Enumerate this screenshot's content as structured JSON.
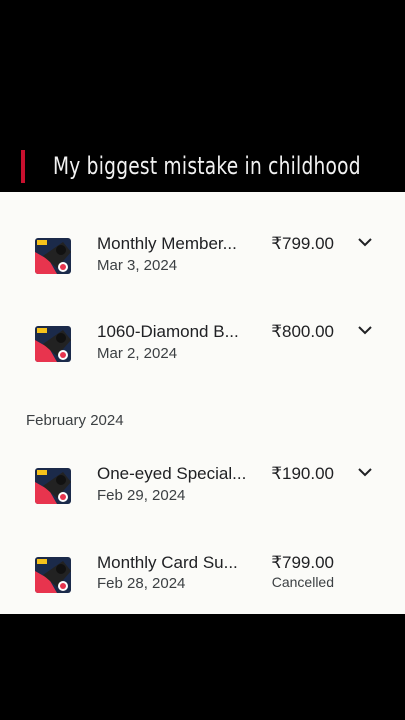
{
  "banner": {
    "title": "My biggest mistake in childhood"
  },
  "transactions_top": [
    {
      "name": "Monthly Member...",
      "date": "Mar 3, 2024",
      "price": "₹799.00",
      "icon": "game-app-icon"
    },
    {
      "name": "1060-Diamond B...",
      "date": "Mar 2, 2024",
      "price": "₹800.00",
      "icon": "game-app-icon"
    }
  ],
  "month_header": "February 2024",
  "transactions_feb": [
    {
      "name": "One-eyed Special...",
      "date": "Feb 29, 2024",
      "price": "₹190.00",
      "icon": "game-app-icon"
    },
    {
      "name": "Monthly Card Su...",
      "date": "Feb 28, 2024",
      "price": "₹799.00",
      "status": "Cancelled",
      "icon": "game-app-icon"
    }
  ],
  "colors": {
    "accent": "#c8102e",
    "list_bg": "#fbfbf8",
    "text": "#202124",
    "muted": "#3c4043"
  }
}
